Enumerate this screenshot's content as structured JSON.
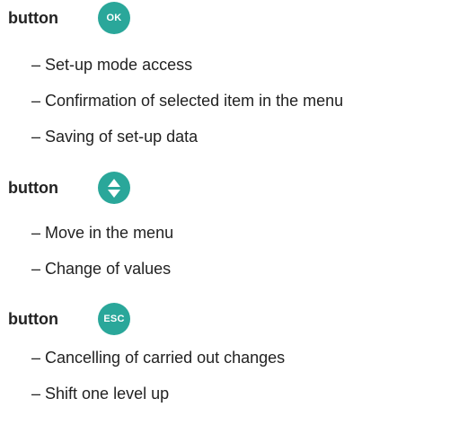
{
  "accent_color": "#2aa79a",
  "sections": [
    {
      "word": "button",
      "badge_text": "OK",
      "icon": "ok-button-icon",
      "items": [
        "– Set-up mode access",
        "– Confirmation of selected item in the menu",
        "– Saving of set-up data"
      ]
    },
    {
      "word": "button",
      "badge_text": "",
      "icon": "up-down-arrows-icon",
      "items": [
        "– Move in the menu",
        "– Change of values"
      ]
    },
    {
      "word": "button",
      "badge_text": "ESC",
      "icon": "esc-button-icon",
      "items": [
        "– Cancelling of carried out changes",
        "– Shift one level up"
      ]
    }
  ]
}
